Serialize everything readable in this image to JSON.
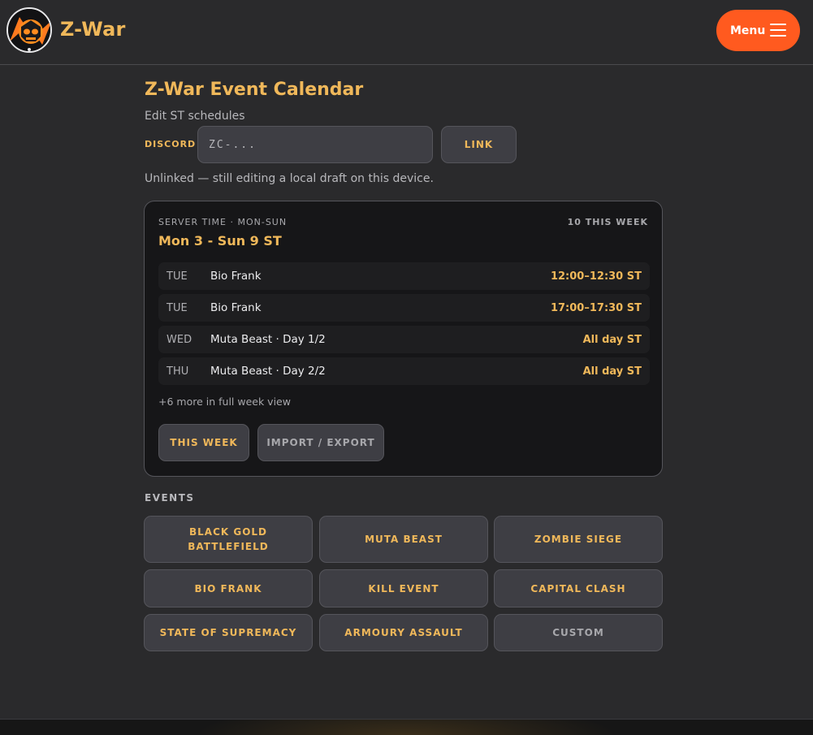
{
  "header": {
    "brand": "Z-War",
    "menu_label": "Menu"
  },
  "page": {
    "title": "Z-War Event Calendar",
    "subtitle": "Edit ST schedules",
    "discord_label": "DISCORD",
    "discord_placeholder": "ZC-...",
    "link_label": "LINK",
    "status_text": "Unlinked — still editing a local draft on this device."
  },
  "week_card": {
    "meta": "SERVER TIME · MON-SUN",
    "count": "10 THIS WEEK",
    "range": "Mon 3 - Sun 9 ST",
    "rows": [
      {
        "day": "TUE",
        "name": "Bio Frank",
        "time": "12:00–12:30 ST"
      },
      {
        "day": "TUE",
        "name": "Bio Frank",
        "time": "17:00–17:30 ST"
      },
      {
        "day": "WED",
        "name": "Muta Beast · Day 1/2",
        "time": "All day ST"
      },
      {
        "day": "THU",
        "name": "Muta Beast · Day 2/2",
        "time": "All day ST"
      }
    ],
    "more_text": "+6 more in full week view",
    "this_week_label": "THIS WEEK",
    "import_export_label": "IMPORT / EXPORT"
  },
  "events": {
    "label": "EVENTS",
    "items": [
      {
        "label": "BLACK GOLD BATTLEFIELD"
      },
      {
        "label": "MUTA BEAST"
      },
      {
        "label": "ZOMBIE SIEGE"
      },
      {
        "label": "BIO FRANK"
      },
      {
        "label": "KILL EVENT"
      },
      {
        "label": "CAPITAL CLASH"
      },
      {
        "label": "STATE OF SUPREMACY"
      },
      {
        "label": "ARMOURY ASSAULT"
      },
      {
        "label": "CUSTOM"
      }
    ]
  },
  "colors": {
    "accent": "#f0b85a",
    "menu": "#ff5a1f",
    "background": "#2a2a2c",
    "card": "#161618"
  }
}
